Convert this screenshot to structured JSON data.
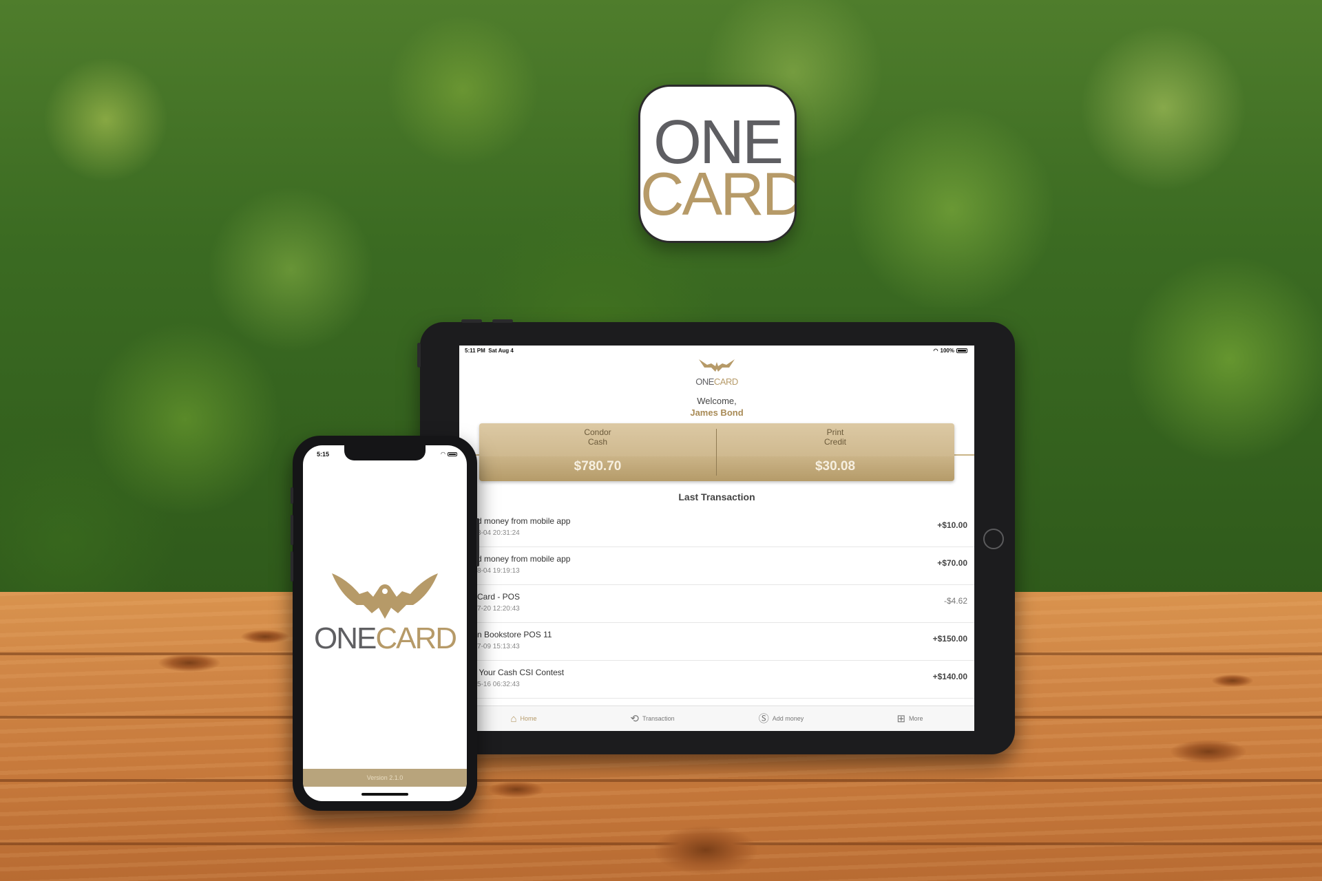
{
  "brand": {
    "word_one": "ONE",
    "word_card": "CARD",
    "gold_color": "#b69a68",
    "gray_color": "#5f5f62"
  },
  "tablet": {
    "status": {
      "time": "5:11 PM",
      "date": "Sat Aug 4",
      "battery": "100%"
    },
    "logo": {
      "one": "ONE",
      "card": "CARD"
    },
    "welcome": "Welcome,",
    "user_name": "James Bond",
    "balances": [
      {
        "label_line1": "Condor",
        "label_line2": "Cash",
        "value": "$780.70"
      },
      {
        "label_line1": "Print",
        "label_line2": "Credit",
        "value": "$30.08"
      }
    ],
    "section_title": "Last Transaction",
    "transactions": [
      {
        "title": "dded money from mobile app",
        "date": "18-08-04 20:31:24",
        "amount": "+$10.00"
      },
      {
        "title": "dded money from mobile app",
        "date": "18-08-04 19:19:13",
        "amount": "+$70.00"
      },
      {
        "title": "NE Card - POS",
        "date": "18-07-20 12:20:43",
        "amount": "-$4.62"
      },
      {
        "title": "ndon Bookstore POS 11",
        "date": "18-07-09 15:13:43",
        "amount": "+$150.00"
      },
      {
        "title": "ash Your Cash CSI Contest",
        "date": "18-05-16 06:32:43",
        "amount": "+$140.00"
      }
    ],
    "tabs": [
      {
        "label": "Home",
        "icon": "home-icon"
      },
      {
        "label": "Transaction",
        "icon": "history-icon"
      },
      {
        "label": "Add money",
        "icon": "dollar-icon"
      },
      {
        "label": "More",
        "icon": "grid-icon"
      }
    ]
  },
  "phone": {
    "status": {
      "time": "5:15"
    },
    "logo": {
      "one": "ONE",
      "card": "CARD"
    },
    "version": "Version 2.1.0"
  }
}
